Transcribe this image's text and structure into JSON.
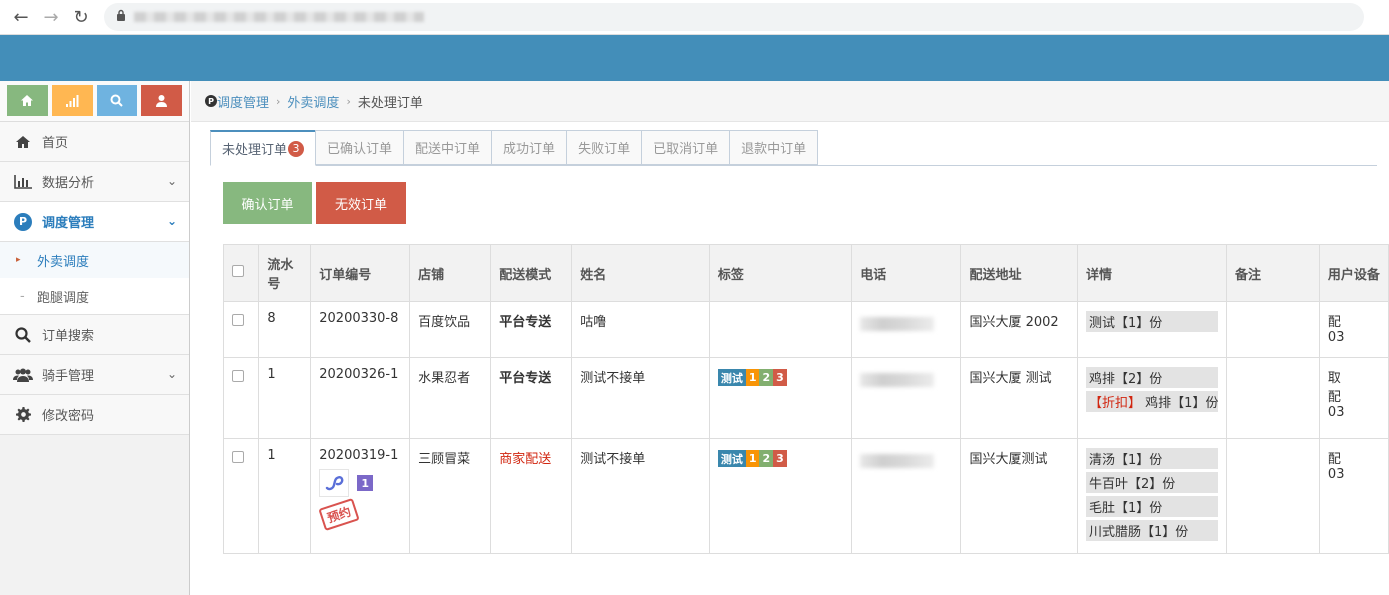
{
  "sidebar": {
    "shortcuts": [
      {
        "icon": "home-icon",
        "color": "#87b87f"
      },
      {
        "icon": "chart-icon",
        "color": "#ffb752"
      },
      {
        "icon": "search-icon",
        "color": "#6fb3e0"
      },
      {
        "icon": "user-icon",
        "color": "#d15b47"
      }
    ],
    "items": [
      {
        "label": "首页",
        "icon": "home-icon"
      },
      {
        "label": "数据分析",
        "icon": "bar-chart-icon"
      },
      {
        "label": "调度管理",
        "icon": "p-icon"
      },
      {
        "label": "订单搜索",
        "icon": "search-icon"
      },
      {
        "label": "骑手管理",
        "icon": "users-icon"
      },
      {
        "label": "修改密码",
        "icon": "gear-icon"
      }
    ],
    "submenu": [
      {
        "label": "外卖调度"
      },
      {
        "label": "跑腿调度"
      }
    ]
  },
  "breadcrumb": [
    "调度管理",
    "外卖调度",
    "未处理订单"
  ],
  "tabs": [
    {
      "label": "未处理订单",
      "badge": "3"
    },
    {
      "label": "已确认订单"
    },
    {
      "label": "配送中订单"
    },
    {
      "label": "成功订单"
    },
    {
      "label": "失败订单"
    },
    {
      "label": "已取消订单"
    },
    {
      "label": "退款中订单"
    }
  ],
  "actions": {
    "confirm": "确认订单",
    "invalid": "无效订单"
  },
  "table": {
    "headers": [
      "流水号",
      "订单编号",
      "店铺",
      "配送模式",
      "姓名",
      "标签",
      "电话",
      "配送地址",
      "详情",
      "备注",
      "用户设备"
    ],
    "rows": [
      {
        "serial": "8",
        "order_no": "20200330-8",
        "shop": "百度饮品",
        "mode": "平台专送",
        "name": "咕噜",
        "tags": [],
        "address": "国兴大厦 2002",
        "details": [
          {
            "text": "测试【1】份"
          }
        ],
        "remark": "",
        "device": [
          "配",
          "03"
        ]
      },
      {
        "serial": "1",
        "order_no": "20200326-1",
        "shop": "水果忍者",
        "mode": "平台专送",
        "name": "测试不接单",
        "tags": [
          "测试",
          "1",
          "2",
          "3"
        ],
        "address": "国兴大厦 测试",
        "details": [
          {
            "text": "鸡排【2】份"
          },
          {
            "prefix": "【折扣】",
            "text": " 鸡排【1】份"
          }
        ],
        "remark": "",
        "device": [
          "取",
          "配",
          "03"
        ]
      },
      {
        "serial": "1",
        "order_no": "20200319-1",
        "shop": "三顾冒菜",
        "mode": "商家配送",
        "name": "测试不接单",
        "tags": [
          "测试",
          "1",
          "2",
          "3"
        ],
        "address": "国兴大厦测试",
        "details": [
          {
            "text": "清汤【1】份"
          },
          {
            "text": "牛百叶【2】份"
          },
          {
            "text": "毛肚【1】份"
          },
          {
            "text": "川式腊肠【1】份"
          }
        ],
        "remark": "",
        "device": [
          "配",
          "03"
        ],
        "order_badge": "1",
        "stamp": "预约"
      }
    ]
  }
}
